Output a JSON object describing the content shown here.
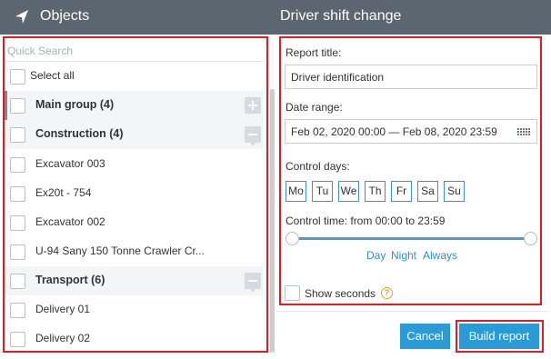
{
  "header": {
    "left_title": "Objects",
    "right_title": "Driver shift change",
    "nav_icon": "navigation-arrow-icon"
  },
  "left": {
    "search_placeholder": "Quick Search",
    "select_all": "Select all",
    "rows": [
      {
        "type": "group",
        "label": "Main group (4)",
        "control": "expand"
      },
      {
        "type": "group",
        "label": "Construction (4)",
        "control": "collapse"
      },
      {
        "type": "item",
        "label": "Excavator 003"
      },
      {
        "type": "item",
        "label": "Ex20t - 754"
      },
      {
        "type": "item",
        "label": "Excavator 002"
      },
      {
        "type": "item",
        "label": "U-94 Sany 150 Tonne Crawler Cr..."
      },
      {
        "type": "group",
        "label": "Transport (6)",
        "control": "collapse"
      },
      {
        "type": "item",
        "label": "Delivery 01"
      },
      {
        "type": "item",
        "label": "Delivery 02"
      }
    ]
  },
  "form": {
    "report_title_label": "Report title:",
    "report_title_value": "Driver identification",
    "date_range_label": "Date range:",
    "date_range_value": "Feb 02, 2020 00:00 — Feb 08, 2020 23:59",
    "control_days_label": "Control days:",
    "days": [
      "Mo",
      "Tu",
      "We",
      "Th",
      "Fr",
      "Sa",
      "Su"
    ],
    "control_time_label": "Control time: from 00:00 to 23:59",
    "time_range": {
      "from": "00:00",
      "to": "23:59"
    },
    "quick_links": {
      "day": "Day",
      "night": "Night",
      "always": "Always"
    },
    "show_seconds_label": "Show seconds",
    "help_glyph": "?"
  },
  "buttons": {
    "cancel": "Cancel",
    "build": "Build report"
  },
  "colors": {
    "header_bg": "#5b6670",
    "accent": "#2a9bd6",
    "highlight": "#e01b24",
    "help": "#e6a817"
  }
}
